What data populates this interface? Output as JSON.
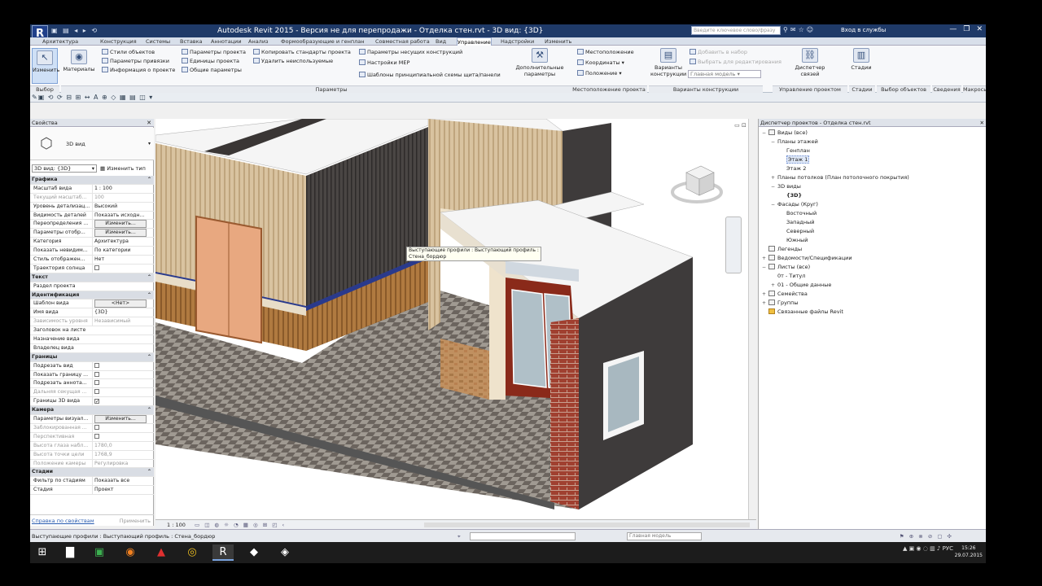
{
  "app": {
    "title": "Autodesk Revit 2015 - Версия не для перепродажи -    Отделка стен.rvt - 3D вид: {3D}",
    "app_button": "R",
    "search_placeholder": "Введите ключевое слово/фразу",
    "sign_in": "Вход в службы"
  },
  "ribbon": {
    "tabs": [
      "Архитектура",
      "Конструкция",
      "Системы",
      "Вставка",
      "Аннотации",
      "Анализ",
      "Формообразующие и генплан",
      "Совместная работа",
      "Вид",
      "Управление",
      "Надстройки",
      "Изменить"
    ],
    "active_tab": "Управление",
    "modify": "Изменить",
    "materials": "Материалы",
    "settings_items": [
      "Стили объектов",
      "Параметры привязки",
      "Информация о проекте",
      "Параметры проекта",
      "Единицы проекта",
      "Общие параметры",
      "Копировать стандарты проекта",
      "Удалить неиспользуемые",
      "Параметры несущих конструкций",
      "Настройки MEP",
      "Шаблоны принципиальной схемы щита/панели"
    ],
    "additional_settings": "Дополнительные параметры",
    "location_items": [
      "Местоположение",
      "Координаты",
      "Положение"
    ],
    "design_options": "Варианты конструкции",
    "design_option_items": [
      "Добавить в набор",
      "Выбрать для редактирования"
    ],
    "main_model": "Главная модель",
    "manage_links": "Диспетчер связей",
    "phases": "Стадии",
    "groups": [
      "Выбор",
      "Параметры",
      "Местоположение проекта",
      "Варианты конструкции",
      "Управление проектом",
      "Стадии",
      "Выбор объектов",
      "Сведения",
      "Макросы"
    ]
  },
  "properties": {
    "title": "Свойства",
    "type_name": "3D вид",
    "view_selector": "3D вид: {3D}",
    "edit_type": "Изменить тип",
    "rows": [
      {
        "k": "sec",
        "l": "Графика"
      },
      {
        "l": "Масштаб вида",
        "v": "1 : 100"
      },
      {
        "l": "Текущий масштаб...",
        "v": "100",
        "dis": true
      },
      {
        "l": "Уровень детализац...",
        "v": "Высокий"
      },
      {
        "l": "Видимость деталей",
        "v": "Показать исходн..."
      },
      {
        "l": "Переопределения ...",
        "v": "Изменить...",
        "btn": true
      },
      {
        "l": "Параметры отобр...",
        "v": "Изменить...",
        "btn": true
      },
      {
        "l": "Категория",
        "v": "Архитектура"
      },
      {
        "l": "Показать невидим...",
        "v": "По категории"
      },
      {
        "l": "Стиль отображен...",
        "v": "Нет"
      },
      {
        "l": "Траектория солнца",
        "cb": ""
      },
      {
        "k": "sec",
        "l": "Текст"
      },
      {
        "l": "Раздел проекта",
        "v": ""
      },
      {
        "k": "sec",
        "l": "Идентификация"
      },
      {
        "l": "Шаблон вида",
        "v": "<Нет>",
        "btn": true
      },
      {
        "l": "Имя вида",
        "v": "{3D}"
      },
      {
        "l": "Зависимость уровня",
        "v": "Независимый",
        "dis": true
      },
      {
        "l": "Заголовок на листе",
        "v": ""
      },
      {
        "l": "Назначение вида",
        "v": ""
      },
      {
        "l": "Владелец вида",
        "v": ""
      },
      {
        "k": "sec",
        "l": "Границы"
      },
      {
        "l": "Подрезать вид",
        "cb": ""
      },
      {
        "l": "Показать границу ...",
        "cb": ""
      },
      {
        "l": "Подрезать аннота...",
        "cb": ""
      },
      {
        "l": "Дальняя секущая ...",
        "cb": "",
        "dis": true
      },
      {
        "l": "Границы 3D вида",
        "cb": "✓"
      },
      {
        "k": "sec",
        "l": "Камера"
      },
      {
        "l": "Параметры визуал...",
        "v": "Изменить...",
        "btn": true
      },
      {
        "l": "Заблокированная ...",
        "cb": "",
        "dis": true
      },
      {
        "l": "Перспективная",
        "cb": "",
        "dis": true
      },
      {
        "l": "Высота глаза набл...",
        "v": "1780,0",
        "dis": true
      },
      {
        "l": "Высота точки цели",
        "v": "1768,9",
        "dis": true
      },
      {
        "l": "Положение камеры",
        "v": "Регулировка",
        "dis": true
      },
      {
        "k": "sec",
        "l": "Стадии"
      },
      {
        "l": "Фильтр по стадиям",
        "v": "Показать все"
      },
      {
        "l": "Стадия",
        "v": "Проект"
      }
    ],
    "help_link": "Справка по свойствам",
    "apply": "Применить"
  },
  "viewport": {
    "tooltip_line1": "Выступающие профили : Выступающий профиль :",
    "tooltip_line2": "Стена_бордюр",
    "scale": "1 : 100"
  },
  "browser": {
    "title": "Диспетчер проектов - Отделка стен.rvt",
    "nodes": [
      {
        "d": 0,
        "t": "−",
        "label": "Виды (все)",
        "icon": "view"
      },
      {
        "d": 1,
        "t": "−",
        "label": "Планы этажей"
      },
      {
        "d": 2,
        "t": "",
        "label": "Генплан"
      },
      {
        "d": 2,
        "t": "",
        "label": "Этаж 1",
        "sel": true
      },
      {
        "d": 2,
        "t": "",
        "label": "Этаж 2"
      },
      {
        "d": 1,
        "t": "+",
        "label": "Планы потолков (План потолочного покрытия)"
      },
      {
        "d": 1,
        "t": "−",
        "label": "3D виды"
      },
      {
        "d": 2,
        "t": "",
        "label": "{3D}",
        "bold": true
      },
      {
        "d": 1,
        "t": "−",
        "label": "Фасады (Круг)"
      },
      {
        "d": 2,
        "t": "",
        "label": "Восточный"
      },
      {
        "d": 2,
        "t": "",
        "label": "Западный"
      },
      {
        "d": 2,
        "t": "",
        "label": "Северный"
      },
      {
        "d": 2,
        "t": "",
        "label": "Южный"
      },
      {
        "d": 0,
        "t": "",
        "label": "Легенды",
        "icon": "view"
      },
      {
        "d": 0,
        "t": "+",
        "label": "Ведомости/Спецификации",
        "icon": "view"
      },
      {
        "d": 0,
        "t": "−",
        "label": "Листы (все)",
        "icon": "view"
      },
      {
        "d": 1,
        "t": "",
        "label": "0т - Титул"
      },
      {
        "d": 1,
        "t": "+",
        "label": "01 - Общие данные"
      },
      {
        "d": 0,
        "t": "+",
        "label": "Семейства",
        "icon": "view"
      },
      {
        "d": 0,
        "t": "+",
        "label": "Группы",
        "icon": "view"
      },
      {
        "d": 0,
        "t": "",
        "label": "Связанные файлы Revit",
        "icon": "fold"
      }
    ]
  },
  "status": {
    "message": "Выступающие профили : Выступающий профиль : Стена_бордюр",
    "model": "Главная модель"
  },
  "taskbar": {
    "lang": "РУС",
    "time": "15:26",
    "date": "29.07.2015"
  },
  "colors": {
    "titlebar": "#1f3a68",
    "accent": "#2a5db0",
    "wall_dark": "#3e3b3b",
    "floor_light": "#a09a92",
    "floor_dark": "#6b645e"
  }
}
